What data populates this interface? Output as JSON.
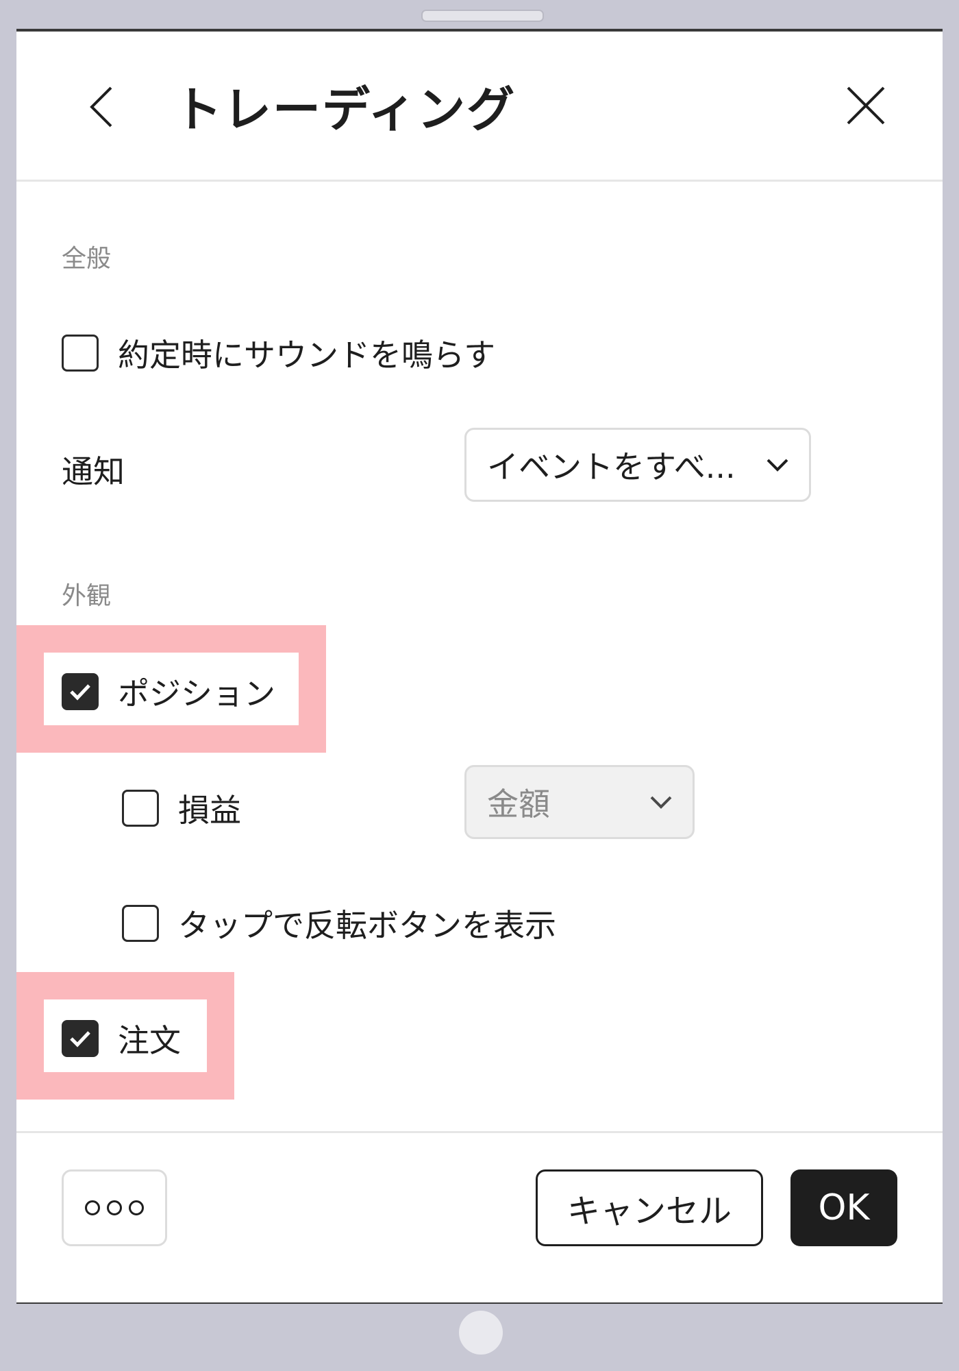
{
  "dialog": {
    "title": "トレーディング",
    "back_icon": "chevron-left-icon",
    "close_icon": "close-icon"
  },
  "general": {
    "section_label": "全般",
    "sound_on_fill": {
      "label": "約定時にサウンドを鳴らす",
      "checked": false
    },
    "notifications": {
      "label": "通知",
      "selected": "イベントをすべ..."
    }
  },
  "appearance": {
    "section_label": "外観",
    "positions": {
      "label": "ポジション",
      "checked": true,
      "highlighted": true
    },
    "pnl": {
      "label": "損益",
      "checked": false,
      "selected": "金額",
      "disabled": true
    },
    "reverse_button": {
      "label": "タップで反転ボタンを表示",
      "checked": false
    },
    "orders": {
      "label": "注文",
      "checked": true,
      "highlighted": true
    }
  },
  "footer": {
    "more_icon": "more-dots-icon",
    "cancel_label": "キャンセル",
    "ok_label": "OK"
  },
  "colors": {
    "highlight": "#fbb8bc",
    "checkbox_checked": "#2a2a2a",
    "ok_button": "#1e1e1e",
    "frame": "#c8c8d4"
  }
}
